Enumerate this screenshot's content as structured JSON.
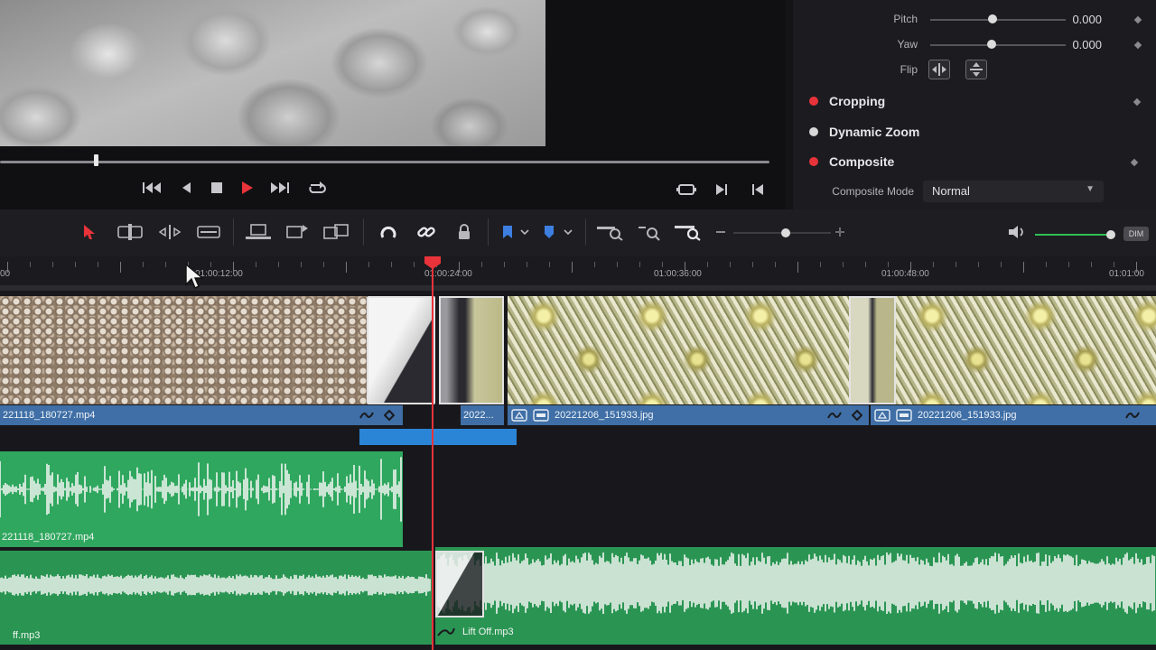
{
  "inspector": {
    "pitch": {
      "label": "Pitch",
      "value": "0.000"
    },
    "yaw": {
      "label": "Yaw",
      "value": "0.000"
    },
    "flip": {
      "label": "Flip"
    },
    "sections": [
      {
        "title": "Cropping",
        "enabled": true
      },
      {
        "title": "Dynamic Zoom",
        "enabled": false
      },
      {
        "title": "Composite",
        "enabled": true
      }
    ],
    "composite_mode": {
      "label": "Composite Mode",
      "value": "Normal"
    }
  },
  "toolbar": {
    "dim_label": "DIM"
  },
  "ruler": {
    "timecodes": [
      "00",
      "01:00:12:00",
      "01:00:24:00",
      "01:00:36:00",
      "01:00:48:00",
      "01:01:00"
    ]
  },
  "video_track": {
    "clips": [
      {
        "label": "221118_180727.mp4"
      },
      {
        "label": "2022..."
      },
      {
        "label": "20221206_151933.jpg"
      },
      {
        "label": "20221206_151933.jpg"
      }
    ]
  },
  "audio_track_1": {
    "clip_label": "221118_180727.mp4"
  },
  "audio_track_2": {
    "clip_left_label": "ff.mp3",
    "clip_right_label": "Lift Off.mp3"
  },
  "colors": {
    "accent_red": "#e8333a",
    "video_clip_blue": "#3f6fa6",
    "audio_clip_green": "#2fa75f",
    "link_blue": "#2b85d6"
  }
}
